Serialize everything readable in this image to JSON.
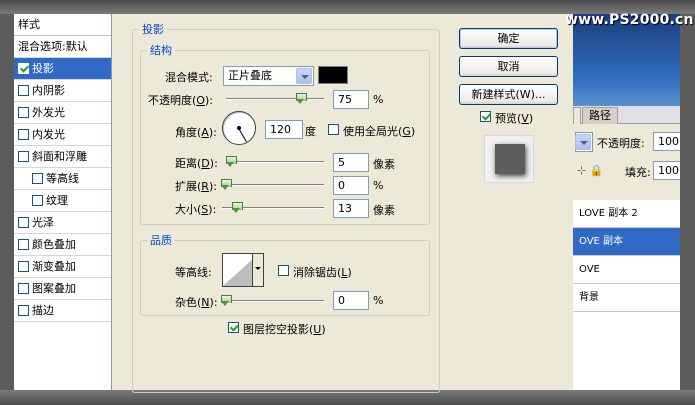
{
  "watermark": "www.PS2000.cn",
  "style_list": {
    "header": "样式",
    "items": [
      {
        "label": "混合选项:默认",
        "checkbox": false,
        "checked": false,
        "selected": false,
        "sub": false
      },
      {
        "label": "投影",
        "checkbox": true,
        "checked": true,
        "selected": true,
        "sub": false
      },
      {
        "label": "内阴影",
        "checkbox": true,
        "checked": false,
        "selected": false,
        "sub": false
      },
      {
        "label": "外发光",
        "checkbox": true,
        "checked": false,
        "selected": false,
        "sub": false
      },
      {
        "label": "内发光",
        "checkbox": true,
        "checked": false,
        "selected": false,
        "sub": false
      },
      {
        "label": "斜面和浮雕",
        "checkbox": true,
        "checked": false,
        "selected": false,
        "sub": false
      },
      {
        "label": "等高线",
        "checkbox": true,
        "checked": false,
        "selected": false,
        "sub": true
      },
      {
        "label": "纹理",
        "checkbox": true,
        "checked": false,
        "selected": false,
        "sub": true
      },
      {
        "label": "光泽",
        "checkbox": true,
        "checked": false,
        "selected": false,
        "sub": false
      },
      {
        "label": "颜色叠加",
        "checkbox": true,
        "checked": false,
        "selected": false,
        "sub": false
      },
      {
        "label": "渐变叠加",
        "checkbox": true,
        "checked": false,
        "selected": false,
        "sub": false
      },
      {
        "label": "图案叠加",
        "checkbox": true,
        "checked": false,
        "selected": false,
        "sub": false
      },
      {
        "label": "描边",
        "checkbox": true,
        "checked": false,
        "selected": false,
        "sub": false
      }
    ]
  },
  "drop_shadow": {
    "title": "投影",
    "structure": {
      "title": "结构",
      "blend_mode_label": "混合模式:",
      "blend_mode_value": "正片叠底",
      "shadow_color": "#000000",
      "opacity_label": "不透明度(",
      "opacity_key": "O",
      "opacity_close": "):",
      "opacity_value": "75",
      "opacity_unit": "%",
      "opacity_level": 0.75,
      "angle_label": "角度(",
      "angle_key": "A",
      "angle_close": "):",
      "angle_value": "120",
      "angle_unit": "度",
      "global_light_label": "使用全局光(",
      "global_light_key": "G",
      "global_light_close": ")",
      "global_light_checked": false,
      "distance_label": "距离(",
      "distance_key": "D",
      "distance_close": "):",
      "distance_value": "5",
      "distance_unit": "像素",
      "spread_label": "扩展(",
      "spread_key": "R",
      "spread_close": "):",
      "spread_value": "0",
      "spread_unit": "%",
      "size_label": "大小(",
      "size_key": "S",
      "size_close": "):",
      "size_value": "13",
      "size_unit": "像素"
    },
    "quality": {
      "title": "品质",
      "contour_label": "等高线:",
      "anti_alias_label": "消除锯齿(",
      "anti_alias_key": "L",
      "anti_alias_close": ")",
      "anti_alias_checked": false,
      "noise_label": "杂色(",
      "noise_key": "N",
      "noise_close": "):",
      "noise_value": "0",
      "noise_unit": "%"
    },
    "knockout_label": "图层挖空投影(",
    "knockout_key": "U",
    "knockout_close": ")",
    "knockout_checked": true
  },
  "buttons": {
    "ok": "确定",
    "cancel": "取消",
    "new_style": "新建样式(W)...",
    "preview_label": "预览(",
    "preview_key": "V",
    "preview_close": ")",
    "preview_checked": true
  },
  "layers_panel": {
    "tabs": [
      "",
      "路径"
    ],
    "opacity_label": "不透明度:",
    "opacity_value": "100",
    "fill_label": "填充:",
    "fill_value": "100",
    "layers": [
      {
        "name": "LOVE 副本 2",
        "selected": false
      },
      {
        "name": "OVE 副本",
        "selected": true
      },
      {
        "name": "OVE",
        "selected": false
      },
      {
        "name": "背景",
        "selected": false
      }
    ]
  }
}
